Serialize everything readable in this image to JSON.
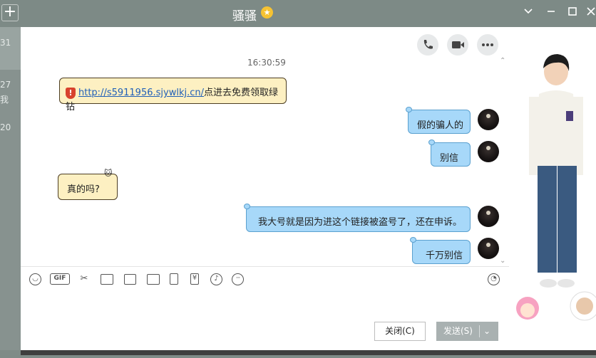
{
  "window": {
    "title": "骚骚",
    "badge_icon": "star-badge-icon",
    "new_button": "+",
    "controls": [
      "chevron-down-icon",
      "minimize-icon",
      "maximize-icon",
      "close-icon"
    ]
  },
  "left_strip": {
    "items": [
      "31",
      "27",
      "我",
      "20"
    ]
  },
  "header_actions": [
    "phone-icon",
    "video-icon",
    "more-icon"
  ],
  "chat": {
    "timestamp": "16:30:59",
    "messages": [
      {
        "side": "left",
        "link": "http://s5911956.sjywlkj.cn/",
        "text": "点进去免费领取绿钻"
      },
      {
        "side": "right",
        "text": "假的骗人的"
      },
      {
        "side": "right",
        "text": "别信"
      },
      {
        "side": "left",
        "text": "真的吗?"
      },
      {
        "side": "right",
        "text": "我大号就是因为进这个链接被盗号了，还在申诉。"
      },
      {
        "side": "right",
        "text": "千万别信"
      }
    ]
  },
  "toolbar": {
    "gif_label": "GIF",
    "red_packet_label": "¥",
    "tools": [
      "emoji-icon",
      "gif-icon",
      "scissors-icon",
      "folder-icon",
      "gallery-icon",
      "image-icon",
      "shake-icon",
      "red-packet-icon",
      "music-icon",
      "more-tools-icon",
      "history-clock-icon"
    ]
  },
  "buttons": {
    "close_label": "关闭(C)",
    "send_label": "发送(S)"
  },
  "colors": {
    "titlebar": "#7d8a86",
    "bubble_self": "#a7d8f9",
    "bubble_other": "#fdf0c2",
    "warning": "#d8422d"
  }
}
